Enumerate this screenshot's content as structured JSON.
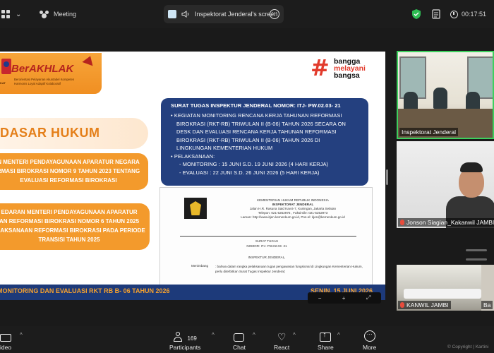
{
  "topbar": {
    "meeting_label": "Meeting",
    "share_title": "Inspektorat Jenderal's screen",
    "timer": "00:17:51"
  },
  "slide": {
    "logo_brand": "BerAKHLAK",
    "logo_tag1": "Berorientasi Pelayanan Akuntabel Kompeten",
    "logo_tag2": "Harmonis Loyal Adaptif Kolaboratif",
    "logo_side": "KAT",
    "bangga_hash": "#",
    "bangga_w1": "bangga",
    "bangga_w2": "melayani",
    "bangga_w3": "bangsa",
    "dasar_title": "DASAR HUKUM",
    "box1": [
      "N MENTERI PENDAYAGUNAAN APARATUR NEGARA",
      "RMASI BIROKRASI NOMOR 9 TAHUN 2023 TENTANG",
      "EVALUASI REFORMASI BIROKRASI"
    ],
    "box2": [
      "EDARAN MENTERI PENDAYAGUNAAN APARATUR",
      "AN REFORMASI BIROKRASI NOMOR 6 TAHUN 2025",
      "ELAKSANAAN REFORMASI BIROKRASI PADA PERIODE",
      "TRANSISI TAHUN 2025"
    ],
    "blue_title": "SURAT TUGAS INSPEKTUR JENDERAL NOMOR: ITJ- PW.02.03- 21",
    "blue_lines": {
      "l1": "KEGIATAN MONITORING RENCANA KERJA TAHUNAN REFORMASI",
      "l2": "BIROKRASI (RKT-RB) TRIWULAN II (B-06) TAHUN 2026 SECARA ON",
      "l3": "DESK DAN EVALUASI RENCANA KERJA TAHUNAN REFORMASI",
      "l4": "BIROKRASI (RKT-RB) TRIWULAN II (B-06) TAHUN 2026 DI",
      "l5": "LINGKUNGAN KEMENTERIAN HUKUM",
      "l6": "PELAKSANAAN:",
      "l7": "- MONITORING : 15 JUNI S.D. 19 JUNI 2026 (4 HARI KERJA)",
      "l8": "- EVALUASI : 22 JUNI S.D. 26 JUNI 2026 (5 HARI KERJA)"
    },
    "letter": {
      "h1": "KEMENTERIAN HUKUM REPUBLIK INDONESIA",
      "h2": "INSPEKTORAT JENDERAL",
      "h3": "Jalan H.R. Rasuna Said Kav.6-7, Kuningan, Jakarta Selatan",
      "h4": "Telepon: 021-5252975 , Faksimile: 021-5252973",
      "h5": "Laman: http://www.itjen.kemenkum.go.id, Pos-el: itjen@kemenkum.go.id",
      "s1": "SURAT TUGAS",
      "s2": "NOMOR: ITJ- PW.02.03- 21",
      "s3": "INSPEKTUR JENDERAL,",
      "menimbang": "Menimbang",
      "body": ": bahwa dalam rangka pelaksanaan tugas pengawasan fungsional di Lingkungan Kementerian Hukum, perlu diterbitkan Surat Tugas Inspektur Jenderal;"
    },
    "footer_left": "MONITORING DAN EVALUASI RKT RB B- 06 TAHUN 2026",
    "footer_right": "SENIN, 15 JUNI 2026"
  },
  "zoombar": {
    "minus": "−",
    "plus": "+",
    "fit": "⤢"
  },
  "tiles": [
    {
      "name": "Inspektorat Jenderal"
    },
    {
      "name": "Jonson Siagian_Kakanwil JAMBI"
    },
    {
      "name": "KANWIL JAMBI"
    },
    {
      "name": "Ba"
    }
  ],
  "toolbar": {
    "video": "ideo",
    "participants": "Participants",
    "participants_count": "169",
    "chat": "Chat",
    "react": "React",
    "share": "Share",
    "more": "More",
    "copyright": "© Copyright | Kartini"
  },
  "colors": {
    "accent_orange": "#f39a2c",
    "slide_blue": "#24407f",
    "active_speaker": "#3ecf5e"
  }
}
